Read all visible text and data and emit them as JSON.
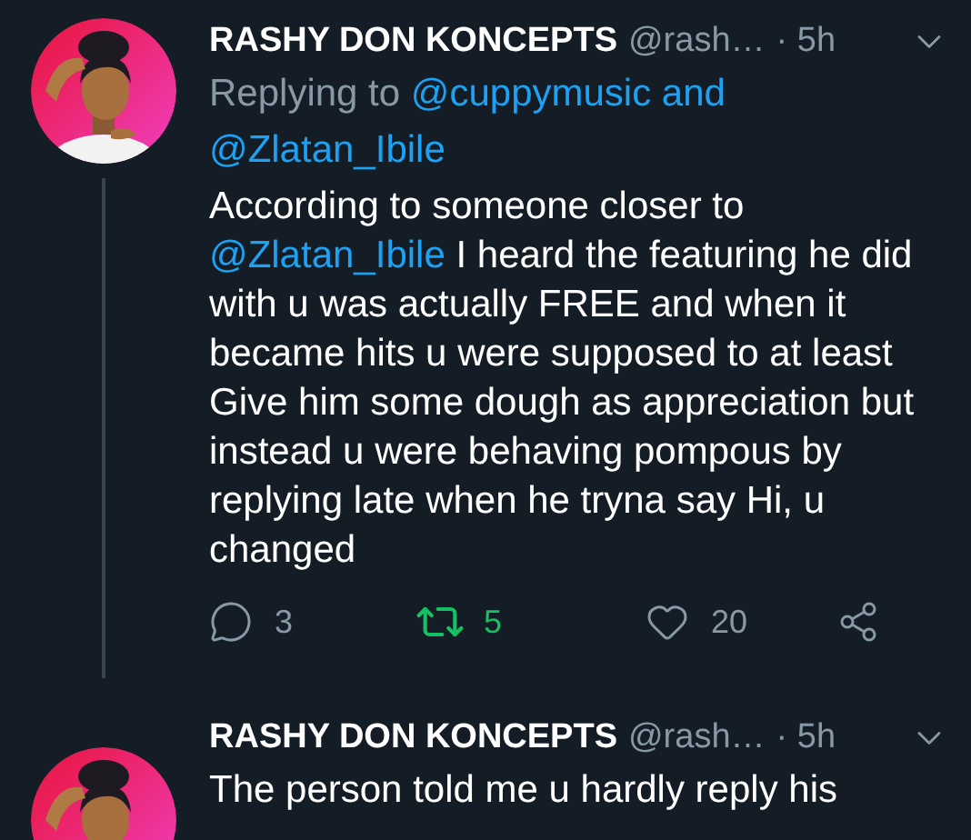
{
  "tweets": [
    {
      "author": "RASHY DON KONCEPTS",
      "handle": "@rash…",
      "time": "· 5h",
      "replying_prefix": "Replying to",
      "replying_to": [
        "@cuppymusic and",
        "@Zlatan_Ibile"
      ],
      "body": [
        {
          "kind": "mention",
          "text": "@Zlatan_Ibile"
        },
        {
          "kind": "text",
          "text": " I heard the featuring he did with u was actually FREE and when it became hits u were supposed to at least Give him some dough as appreciation but instead u were behaving pompous by replying late when he tryna say Hi, u changed"
        }
      ],
      "body_prefix": "According to someone closer to ",
      "actions": {
        "replies": "3",
        "retweets": "5",
        "retweeted": true,
        "likes": "20",
        "liked": false
      }
    },
    {
      "author": "RASHY DON KONCEPTS",
      "handle": "@rash…",
      "time": "· 5h",
      "body_prefix": "The person told me u hardly reply his"
    }
  ]
}
